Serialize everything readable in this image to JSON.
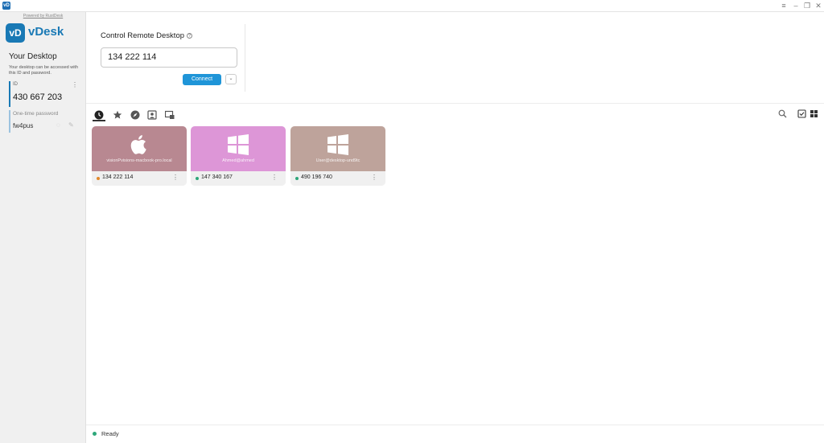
{
  "app": {
    "icon_text": "vD",
    "window_controls": [
      "≡",
      "–",
      "❐",
      "✕"
    ]
  },
  "sidebar": {
    "powered_by": "Powered by RustDesk",
    "logo_badge": "vD",
    "logo_text": "vDesk",
    "heading": "Your Desktop",
    "description": "Your desktop can be accessed with this ID and password.",
    "id_label": "ID",
    "id_value": "430 667 203",
    "otp_label": "One-time password",
    "otp_value": "fw4pus"
  },
  "connect": {
    "title": "Control Remote Desktop",
    "input_value": "134 222 114",
    "connect_label": "Connect"
  },
  "tabs": [
    {
      "name": "recent",
      "icon": "clock-icon",
      "active": true
    },
    {
      "name": "favorites",
      "icon": "star-icon",
      "active": false
    },
    {
      "name": "discovered",
      "icon": "compass-icon",
      "active": false
    },
    {
      "name": "address-book",
      "icon": "address-book-icon",
      "active": false
    },
    {
      "name": "group",
      "icon": "group-icon",
      "active": false
    }
  ],
  "tools": [
    "search-icon",
    "select-checkbox-icon",
    "grid-view-icon"
  ],
  "peers": [
    {
      "os": "mac",
      "hostname": "visionPvisions-macbook-pro.local",
      "id": "134 222 114",
      "color": "#b88891",
      "status_color": "#e2892a"
    },
    {
      "os": "windows",
      "hostname": "Ahmed@ahmed",
      "id": "147 340 167",
      "color": "#dd96d7",
      "status_color": "#2ea77a"
    },
    {
      "os": "windows",
      "hostname": "User@desktop-und9tc",
      "id": "490 196 740",
      "color": "#bea39b",
      "status_color": "#2ea77a"
    }
  ],
  "status": {
    "text": "Ready",
    "color": "#2ea77a"
  }
}
